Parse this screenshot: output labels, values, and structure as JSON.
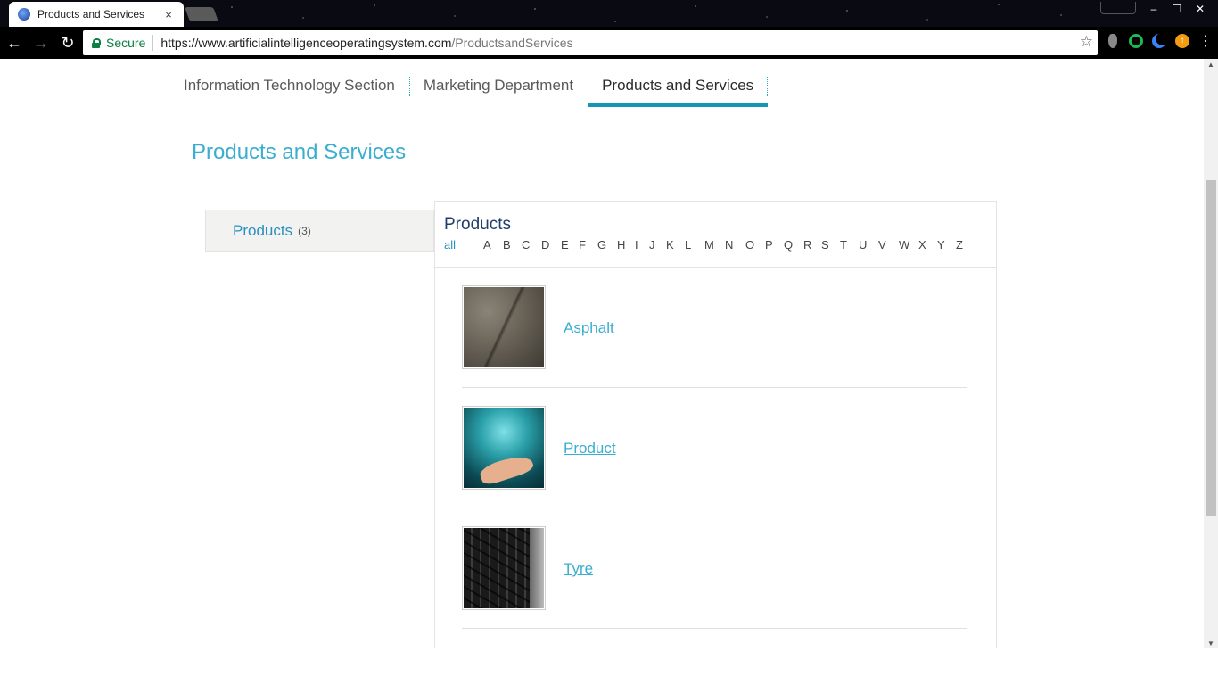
{
  "browser": {
    "tab_title": "Products and Services",
    "tab_close": "×",
    "secure_label": "Secure",
    "url_host": "https://www.artificialintelligenceoperatingsystem.com",
    "url_path": "/ProductsandServices",
    "window": {
      "minimize": "–",
      "restore": "❐",
      "close": "✕"
    }
  },
  "topnav": {
    "items": [
      {
        "label": "Information Technology Section"
      },
      {
        "label": "Marketing Department"
      },
      {
        "label": "Products and Services",
        "active": true
      }
    ]
  },
  "page": {
    "title": "Products and Services"
  },
  "sidebar": {
    "link_label": "Products",
    "count": "(3)"
  },
  "panel": {
    "title": "Products",
    "alphabet": [
      "all",
      "A",
      "B",
      "C",
      "D",
      "E",
      "F",
      "G",
      "H",
      "I",
      "J",
      "K",
      "L",
      "M",
      "N",
      "O",
      "P",
      "Q",
      "R",
      "S",
      "T",
      "U",
      "V",
      "W",
      "X",
      "Y",
      "Z"
    ],
    "items": [
      {
        "name": "Asphalt"
      },
      {
        "name": "Product"
      },
      {
        "name": "Tyre"
      }
    ]
  },
  "colors": {
    "accent": "#3aaed0",
    "active_underline": "#1597b3",
    "title_dark": "#1f3e6a",
    "secure": "#0b8043"
  }
}
